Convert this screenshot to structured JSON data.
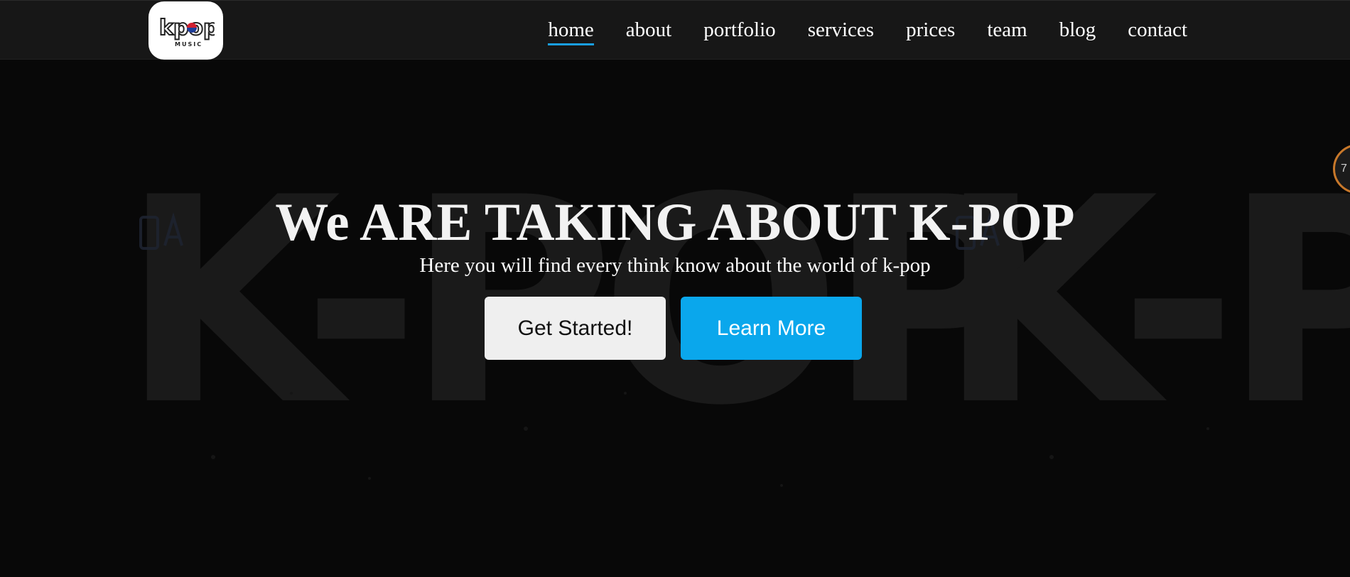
{
  "nav": {
    "logo_alt": "K-pop Music",
    "logo_text": "kpop",
    "logo_subtext": "MUSIC",
    "links": [
      {
        "label": "home",
        "active": true
      },
      {
        "label": "about",
        "active": false
      },
      {
        "label": "portfolio",
        "active": false
      },
      {
        "label": "services",
        "active": false
      },
      {
        "label": "prices",
        "active": false
      },
      {
        "label": "team",
        "active": false
      },
      {
        "label": "blog",
        "active": false
      },
      {
        "label": "contact",
        "active": false
      }
    ]
  },
  "hero": {
    "title": "We ARE TAKING ABOUT K-POP",
    "subtitle": "Here you will find every think know about the world of k-pop",
    "background_text": "K-POP",
    "buttons": {
      "get_started": "Get Started!",
      "learn_more": "Learn More"
    }
  },
  "side_widget": {
    "label": "7"
  },
  "colors": {
    "navbar_bg": "#171717",
    "page_bg": "#080808",
    "accent": "#0aa7ec",
    "active_underline": "#1a9fe0",
    "widget_ring": "#c8782a"
  }
}
